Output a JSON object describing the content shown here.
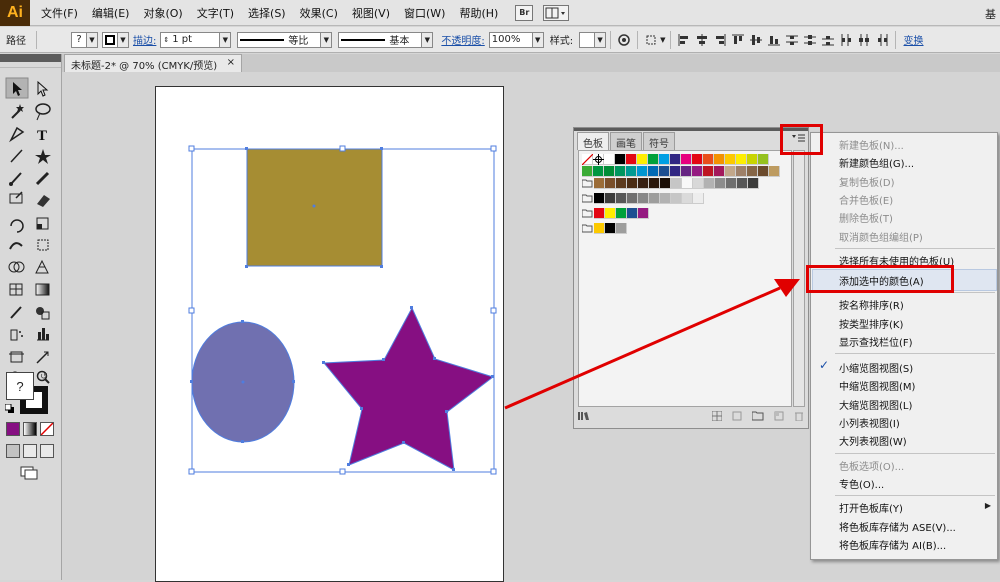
{
  "app": {
    "logo": "Ai",
    "menus": [
      "文件(F)",
      "编辑(E)",
      "对象(O)",
      "文字(T)",
      "选择(S)",
      "效果(C)",
      "视图(V)",
      "窗口(W)",
      "帮助(H)"
    ],
    "br_label": "Br",
    "menubar_right": "基"
  },
  "control_bar": {
    "object_type": "路径",
    "fill_value": "?",
    "stroke_label": "描边:",
    "stroke_weight": "1 pt",
    "profile_label": "等比",
    "brush_label": "基本",
    "opacity_label": "不透明度:",
    "opacity_value": "100%",
    "style_label": "样式:",
    "transform_label": "变换"
  },
  "document": {
    "tab_title": "未标题-2* @ 70% (CMYK/预览)",
    "close": "×"
  },
  "tools": {
    "fill_stroke_unknown": "?"
  },
  "shapes": {
    "rect_color": "#a68d33",
    "ellipse_color": "#7070b0",
    "star_color": "#860f82",
    "selection_color": "#4f7ddf"
  },
  "swatch_panel": {
    "tabs": [
      "色板",
      "画笔",
      "符号"
    ],
    "row1": [
      "#ffffff",
      "#000000",
      "#e30613",
      "#ffed00",
      "#00a13a",
      "#009fe3",
      "#312783",
      "#e6007e",
      "#e30613",
      "#e94e1b",
      "#f39200",
      "#fcc900",
      "#fdee00",
      "#c8d400",
      "#95c11f"
    ],
    "row2": [
      "#3aaa35",
      "#009640",
      "#008d36",
      "#00965e",
      "#009a93",
      "#0096d1",
      "#0069b4",
      "#1d4f91",
      "#312783",
      "#662483",
      "#951b81",
      "#be1622",
      "#a3195b",
      "#c2a78a",
      "#9e8068",
      "#866647",
      "#6b4a2c",
      "#bd9b60"
    ],
    "row3": [
      "#9b6c38",
      "#7a4f2a",
      "#5d3b1e",
      "#4a2c14",
      "#372012",
      "#2a170a",
      "#1a0e05",
      "#c6c6c6",
      "#f8f8f8",
      "#d8d8d8",
      "#b2b2b2",
      "#8d8d8d",
      "#6f6f6f",
      "#575757",
      "#3c3c3b"
    ],
    "row4": [
      "#000000",
      "#3c3c3b",
      "#575757",
      "#706f6f",
      "#878787",
      "#9d9d9c",
      "#b2b2b2",
      "#c6c6c6",
      "#dadada",
      "#ededed"
    ],
    "row5": [
      "#e30613",
      "#ffed00",
      "#00a13a",
      "#1d4f91",
      "#951b81"
    ],
    "row6": [
      "#fcc900",
      "#000000",
      "#9d9d9c"
    ]
  },
  "flyout_menu": {
    "items": [
      {
        "label": "新建色板(N)...",
        "disabled": true
      },
      {
        "label": "新建颜色组(G)...",
        "disabled": false
      },
      {
        "label": "复制色板(D)",
        "disabled": true
      },
      {
        "label": "合并色板(E)",
        "disabled": true
      },
      {
        "label": "删除色板(T)",
        "disabled": true
      },
      {
        "label": "取消颜色组编组(P)",
        "disabled": true
      },
      {
        "label": "选择所有未使用的色板(U)",
        "disabled": false
      },
      {
        "label": "添加选中的颜色(A)",
        "disabled": false
      },
      {
        "label": "按名称排序(R)",
        "disabled": false
      },
      {
        "label": "按类型排序(K)",
        "disabled": false
      },
      {
        "label": "显示查找栏位(F)",
        "disabled": false
      },
      {
        "label": "小缩览图视图(S)",
        "disabled": false,
        "checked": true
      },
      {
        "label": "中缩览图视图(M)",
        "disabled": false
      },
      {
        "label": "大缩览图视图(L)",
        "disabled": false
      },
      {
        "label": "小列表视图(I)",
        "disabled": false
      },
      {
        "label": "大列表视图(W)",
        "disabled": false
      },
      {
        "label": "色板选项(O)...",
        "disabled": true
      },
      {
        "label": "专色(O)...",
        "disabled": false
      },
      {
        "label": "打开色板库(Y)",
        "disabled": false,
        "submenu": true
      },
      {
        "label": "将色板库存储为 ASE(V)...",
        "disabled": false
      },
      {
        "label": "将色板库存储为 AI(B)...",
        "disabled": false
      }
    ]
  },
  "annotation_color": "#e00000"
}
